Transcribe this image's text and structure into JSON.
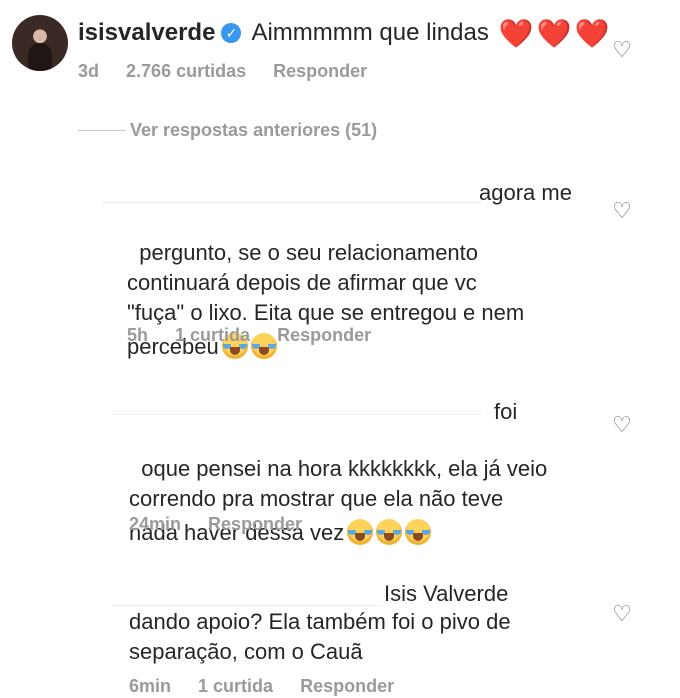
{
  "main_comment": {
    "username": "isisvalverde",
    "text": "Aimmmmm que lindas",
    "hearts": "❤️❤️❤️",
    "time": "3d",
    "likes": "2.766 curtidas",
    "reply": "Responder"
  },
  "replies_toggle": {
    "label": "Ver respostas anteriores (51)"
  },
  "replies": [
    {
      "first_line": "agora me",
      "body": "pergunto, se o seu relacionamento\ncontinuará depois de afirmar que vc\n\"fuça\" o lixo. Eita que se entregou e nem\npercebeu",
      "time": "5h",
      "likes": "1 curtida",
      "reply": "Responder",
      "emoji_count": 2
    },
    {
      "first_line": "foi",
      "body": "oque pensei na hora kkkkkkkk, ela já veio\ncorrendo pra mostrar que ela não teve\nnada haver dessa vez",
      "time": "24min",
      "likes": "",
      "reply": "Responder",
      "emoji_count": 3
    },
    {
      "first_line": "Isis Valverde",
      "body": "dando apoio? Ela também foi o pivo de\nseparação, com o Cauã",
      "time": "6min",
      "likes": "1 curtida",
      "reply": "Responder",
      "emoji_count": 0
    }
  ],
  "icons": {
    "verified": "verified-badge-icon",
    "heart": "heart-outline-icon"
  },
  "colors": {
    "text": "#262626",
    "muted": "#9a9a9a",
    "verified": "#3897f0",
    "heart": "#e0202a"
  }
}
